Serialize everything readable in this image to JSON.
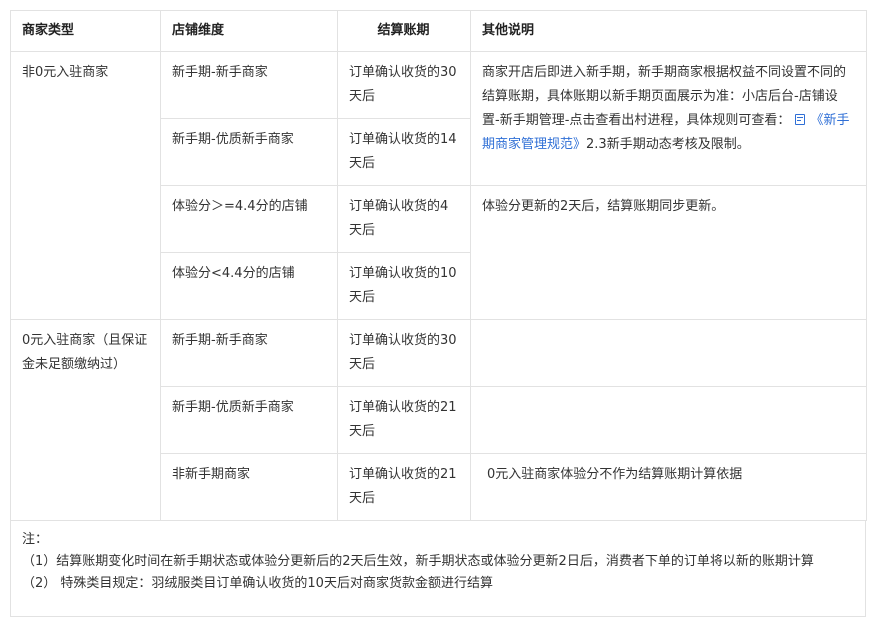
{
  "table": {
    "headers": [
      "商家类型",
      "店铺维度",
      "结算账期",
      "其他说明"
    ],
    "group1": {
      "merchant_type": "非0元入驻商家",
      "rows": [
        {
          "dimension": "新手期-新手商家",
          "period": "订单确认收货的30天后"
        },
        {
          "dimension": "新手期-优质新手商家",
          "period": "订单确认收货的14天后"
        },
        {
          "dimension": "体验分＞=4.4分的店铺",
          "period": "订单确认收货的4天后"
        },
        {
          "dimension": "体验分<4.4分的店铺",
          "period": "订单确认收货的10天后"
        }
      ],
      "note_newbie_prefix": "商家开店后即进入新手期，新手期商家根据权益不同设置不同的结算账期，具体账期以新手期页面展示为准：小店后台-店铺设置-新手期管理-点击查看出村进程，具体规则可查看：",
      "note_newbie_link": "《新手期商家管理规范》",
      "note_newbie_suffix": "2.3新手期动态考核及限制。",
      "note_score": "体验分更新的2天后，结算账期同步更新。"
    },
    "group2": {
      "merchant_type": "0元入驻商家（且保证金未足额缴纳过）",
      "rows": [
        {
          "dimension": "新手期-新手商家",
          "period": "订单确认收货的30天后"
        },
        {
          "dimension": "新手期-优质新手商家",
          "period": "订单确认收货的21天后"
        },
        {
          "dimension": "非新手期商家",
          "period": "订单确认收货的21天后"
        }
      ],
      "note_last": "0元入驻商家体验分不作为结算账期计算依据"
    }
  },
  "notes": {
    "title": "注：",
    "item1": "（1）结算账期变化时间在新手期状态或体验分更新后的2天后生效，新手期状态或体验分更新2日后，消费者下单的订单将以新的账期计算",
    "item2": "（2） 特殊类目规定：羽绒服类目订单确认收货的10天后对商家货款金额进行结算"
  },
  "colors": {
    "link": "#2f6fd6",
    "border": "#e2e2e2",
    "text": "#333333"
  }
}
